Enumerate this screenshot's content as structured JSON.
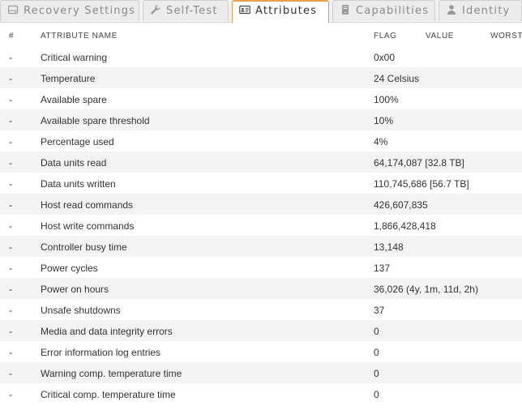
{
  "tabs": [
    {
      "label": "Recovery Settings",
      "icon": "disk-icon",
      "active": false
    },
    {
      "label": "Self-Test",
      "icon": "wrench-icon",
      "active": false
    },
    {
      "label": "Attributes",
      "icon": "id-card-icon",
      "active": true
    },
    {
      "label": "Capabilities",
      "icon": "drive-icon",
      "active": false
    },
    {
      "label": "Identity",
      "icon": "user-icon",
      "active": false
    }
  ],
  "table": {
    "headers": {
      "num": "#",
      "name": "ATTRIBUTE NAME",
      "flag": "FLAG",
      "value": "VALUE",
      "worst": "WORST"
    },
    "rows": [
      {
        "num": "-",
        "name": "Critical warning",
        "flag": "0x00"
      },
      {
        "num": "-",
        "name": "Temperature",
        "flag": "24 Celsius"
      },
      {
        "num": "-",
        "name": "Available spare",
        "flag": "100%"
      },
      {
        "num": "-",
        "name": "Available spare threshold",
        "flag": "10%"
      },
      {
        "num": "-",
        "name": "Percentage used",
        "flag": "4%"
      },
      {
        "num": "-",
        "name": "Data units read",
        "flag": "64,174,087 [32.8 TB]"
      },
      {
        "num": "-",
        "name": "Data units written",
        "flag": "110,745,686 [56.7 TB]"
      },
      {
        "num": "-",
        "name": "Host read commands",
        "flag": "426,607,835"
      },
      {
        "num": "-",
        "name": "Host write commands",
        "flag": "1,866,428,418"
      },
      {
        "num": "-",
        "name": "Controller busy time",
        "flag": "13,148"
      },
      {
        "num": "-",
        "name": "Power cycles",
        "flag": "137"
      },
      {
        "num": "-",
        "name": "Power on hours",
        "flag": "36,026 (4y, 1m, 11d, 2h)"
      },
      {
        "num": "-",
        "name": "Unsafe shutdowns",
        "flag": "37"
      },
      {
        "num": "-",
        "name": "Media and data integrity errors",
        "flag": "0"
      },
      {
        "num": "-",
        "name": "Error information log entries",
        "flag": "0"
      },
      {
        "num": "-",
        "name": "Warning comp. temperature time",
        "flag": "0"
      },
      {
        "num": "-",
        "name": "Critical comp. temperature time",
        "flag": "0"
      }
    ]
  },
  "colors": {
    "active_tab_border": "#e8a04a",
    "row_stripe": "#f3f3f3"
  }
}
